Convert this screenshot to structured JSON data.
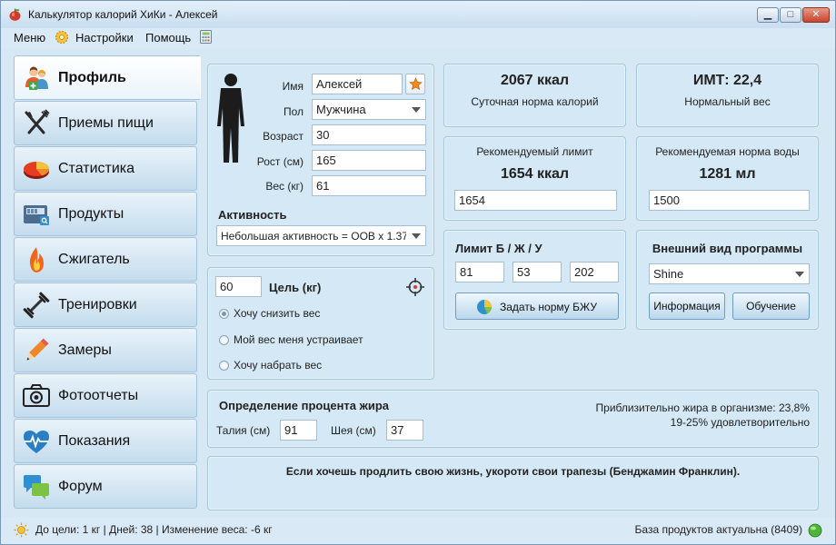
{
  "window": {
    "title": "Калькулятор калорий ХиКи - Алексей"
  },
  "menu": {
    "items": [
      "Меню",
      "Настройки",
      "Помощь"
    ]
  },
  "sidebar": {
    "items": [
      {
        "label": "Профиль",
        "icon": "people-icon",
        "active": true
      },
      {
        "label": "Приемы пищи",
        "icon": "fork-knife-icon"
      },
      {
        "label": "Статистика",
        "icon": "pie-chart-icon"
      },
      {
        "label": "Продукты",
        "icon": "scale-icon"
      },
      {
        "label": "Сжигатель",
        "icon": "flame-icon"
      },
      {
        "label": "Тренировки",
        "icon": "dumbbell-icon"
      },
      {
        "label": "Замеры",
        "icon": "pencil-icon"
      },
      {
        "label": "Фотоотчеты",
        "icon": "camera-icon"
      },
      {
        "label": "Показания",
        "icon": "heart-pulse-icon"
      },
      {
        "label": "Форум",
        "icon": "chat-icon"
      }
    ]
  },
  "profile": {
    "name_label": "Имя",
    "name": "Алексей",
    "gender_label": "Пол",
    "gender": "Мужчина",
    "age_label": "Возраст",
    "age": "30",
    "height_label": "Рост (см)",
    "height": "165",
    "weight_label": "Вес (кг)",
    "weight": "61",
    "activity_label": "Активность",
    "activity": "Небольшая активность = ООВ х 1.375"
  },
  "goal": {
    "value": "60",
    "label": "Цель (кг)",
    "options": [
      "Хочу снизить вес",
      "Мой вес меня устраивает",
      "Хочу набрать вес"
    ],
    "selected": 0
  },
  "calories": {
    "value": "2067 ккал",
    "caption": "Суточная норма калорий"
  },
  "bmi": {
    "value": "ИМТ: 22,4",
    "caption": "Нормальный вес"
  },
  "limit": {
    "caption": "Рекомендуемый лимит",
    "value": "1654 ккал",
    "input": "1654"
  },
  "water": {
    "caption": "Рекомендуемая норма воды",
    "value": "1281 мл",
    "input": "1500"
  },
  "bju": {
    "title": "Лимит Б / Ж / У",
    "protein": "81",
    "fat": "53",
    "carbs": "202",
    "button": "Задать норму БЖУ"
  },
  "appearance": {
    "title": "Внешний вид программы",
    "theme": "Shine",
    "info_button": "Информация",
    "training_button": "Обучение"
  },
  "fat": {
    "title": "Определение процента жира",
    "waist_label": "Талия (см)",
    "waist": "91",
    "neck_label": "Шея (см)",
    "neck": "37",
    "result_line1": "Приблизительно жира в организме: 23,8%",
    "result_line2": "19-25% удовлетворительно"
  },
  "quote": "Если хочешь продлить свою жизнь, укороти свои трапезы (Бенджамин Франклин).",
  "status": {
    "left": "До цели: 1 кг | Дней: 38 | Изменение веса: -6 кг",
    "right": "База продуктов актуальна (8409)"
  }
}
